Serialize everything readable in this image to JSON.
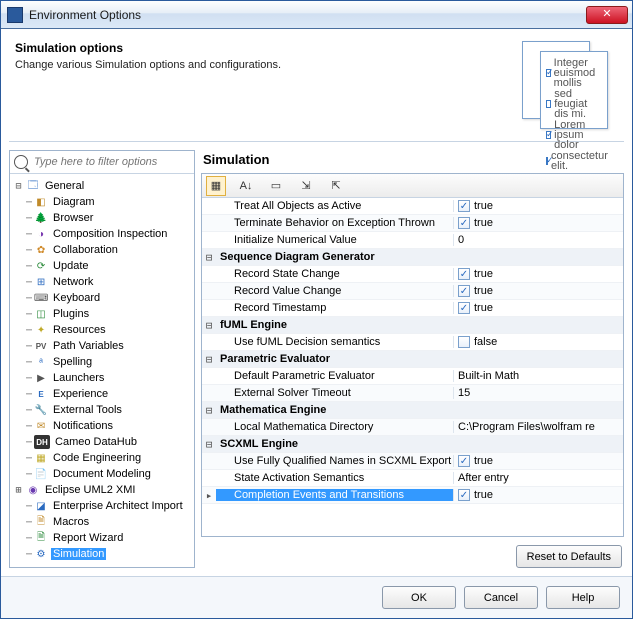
{
  "window": {
    "title": "Environment Options"
  },
  "header": {
    "title": "Simulation options",
    "subtitle": "Change various Simulation options and configurations."
  },
  "decor_lines": [
    "Integer euismod mollis",
    "sed feugiat dis mi.",
    "Lorem ipsum dolor",
    "consectetur elit."
  ],
  "filter": {
    "placeholder": "Type here to filter options"
  },
  "tree": [
    {
      "id": "general",
      "label": "General",
      "depth": 0,
      "exp": "minus",
      "icon": "🗔",
      "icolor": "#2a6ac0"
    },
    {
      "id": "diagram",
      "label": "Diagram",
      "depth": 1,
      "icon": "◧",
      "icolor": "#c08a2a"
    },
    {
      "id": "browser",
      "label": "Browser",
      "depth": 1,
      "icon": "🌲",
      "icolor": "#2a8a3a"
    },
    {
      "id": "composition",
      "label": "Composition Inspection",
      "depth": 1,
      "icon": "◑",
      "icolor": "#7a3ab0"
    },
    {
      "id": "collab",
      "label": "Collaboration",
      "depth": 1,
      "icon": "✿",
      "icolor": "#d08a2a"
    },
    {
      "id": "update",
      "label": "Update",
      "depth": 1,
      "icon": "⟳",
      "icolor": "#2a8a3a"
    },
    {
      "id": "network",
      "label": "Network",
      "depth": 1,
      "icon": "⊞",
      "icolor": "#2a6ac0"
    },
    {
      "id": "keyboard",
      "label": "Keyboard",
      "depth": 1,
      "icon": "⌨",
      "icolor": "#555"
    },
    {
      "id": "plugins",
      "label": "Plugins",
      "depth": 1,
      "icon": "◫",
      "icolor": "#2a8a3a"
    },
    {
      "id": "resources",
      "label": "Resources",
      "depth": 1,
      "icon": "✦",
      "icolor": "#c0aa2a"
    },
    {
      "id": "pathvars",
      "label": "Path Variables",
      "depth": 1,
      "icon": "PV",
      "icolor": "#555",
      "textIcon": true
    },
    {
      "id": "spelling",
      "label": "Spelling",
      "depth": 1,
      "icon": "ᵃ",
      "icolor": "#2a6ac0"
    },
    {
      "id": "launchers",
      "label": "Launchers",
      "depth": 1,
      "icon": "▶",
      "icolor": "#555"
    },
    {
      "id": "experience",
      "label": "Experience",
      "depth": 1,
      "icon": "E",
      "icolor": "#2a6ac0",
      "textIcon": true
    },
    {
      "id": "exttools",
      "label": "External Tools",
      "depth": 1,
      "icon": "🔧",
      "icolor": "#555"
    },
    {
      "id": "notifications",
      "label": "Notifications",
      "depth": 1,
      "icon": "✉",
      "icolor": "#c08a2a"
    },
    {
      "id": "datahub",
      "label": "Cameo DataHub",
      "depth": 1,
      "icon": "DH",
      "icolor": "#fff",
      "bg": "#333",
      "textIcon": true
    },
    {
      "id": "codeeng",
      "label": "Code Engineering",
      "depth": 1,
      "icon": "▦",
      "icolor": "#c0aa2a"
    },
    {
      "id": "docmodel",
      "label": "Document Modeling",
      "depth": 1,
      "icon": "📄",
      "icolor": "#2a6ac0"
    },
    {
      "id": "eclipse",
      "label": "Eclipse UML2 XMI",
      "depth": 0,
      "exp": "plus",
      "icon": "◉",
      "icolor": "#6a3ab0"
    },
    {
      "id": "eaimport",
      "label": "Enterprise Architect Import",
      "depth": 1,
      "icon": "◪",
      "icolor": "#2a6ac0"
    },
    {
      "id": "macros",
      "label": "Macros",
      "depth": 1,
      "icon": "🗎",
      "icolor": "#c08a2a"
    },
    {
      "id": "report",
      "label": "Report Wizard",
      "depth": 1,
      "icon": "🗎",
      "icolor": "#2a8a3a"
    },
    {
      "id": "simulation",
      "label": "Simulation",
      "depth": 1,
      "icon": "⚙",
      "icolor": "#2a6ac0",
      "selected": true
    }
  ],
  "panel": {
    "title": "Simulation"
  },
  "rows": [
    {
      "type": "prop",
      "name": "Treat All Objects as Active",
      "val": "true",
      "check": true
    },
    {
      "type": "prop",
      "name": "Terminate Behavior on Exception Thrown",
      "val": "true",
      "check": true
    },
    {
      "type": "prop",
      "name": "Initialize Numerical Value",
      "val": "0"
    },
    {
      "type": "group",
      "name": "Sequence Diagram Generator"
    },
    {
      "type": "prop",
      "name": "Record State Change",
      "val": "true",
      "check": true
    },
    {
      "type": "prop",
      "name": "Record Value Change",
      "val": "true",
      "check": true
    },
    {
      "type": "prop",
      "name": "Record Timestamp",
      "val": "true",
      "check": true
    },
    {
      "type": "group",
      "name": "fUML Engine"
    },
    {
      "type": "prop",
      "name": "Use fUML Decision semantics",
      "val": "false",
      "check": false
    },
    {
      "type": "group",
      "name": "Parametric Evaluator"
    },
    {
      "type": "prop",
      "name": "Default Parametric Evaluator",
      "val": "Built-in Math"
    },
    {
      "type": "prop",
      "name": "External Solver Timeout",
      "val": "15"
    },
    {
      "type": "group",
      "name": "Mathematica Engine"
    },
    {
      "type": "prop",
      "name": "Local Mathematica Directory",
      "val": "C:\\Program Files\\wolfram re"
    },
    {
      "type": "group",
      "name": "SCXML Engine"
    },
    {
      "type": "prop",
      "name": "Use Fully Qualified Names in SCXML Export",
      "val": "true",
      "check": true
    },
    {
      "type": "prop",
      "name": "State Activation Semantics",
      "val": "After entry"
    },
    {
      "type": "prop",
      "name": "Completion Events and Transitions",
      "val": "true",
      "check": true,
      "selected": true,
      "arrow": true
    }
  ],
  "buttons": {
    "reset": "Reset to Defaults",
    "ok": "OK",
    "cancel": "Cancel",
    "help": "Help"
  }
}
